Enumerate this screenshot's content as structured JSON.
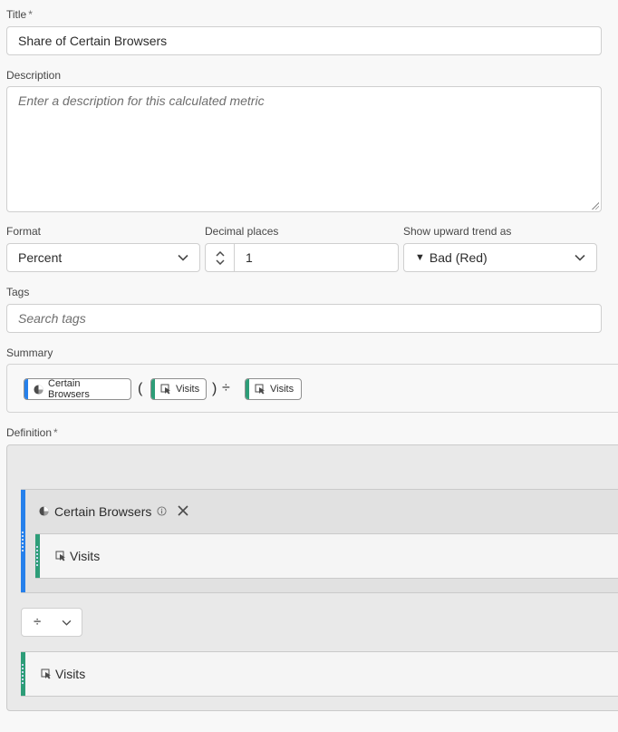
{
  "title_field": {
    "label": "Title",
    "required_mark": "*",
    "value": "Share of Certain Browsers"
  },
  "description_field": {
    "label": "Description",
    "placeholder": "Enter a description for this calculated metric"
  },
  "format_field": {
    "label": "Format",
    "value": "Percent"
  },
  "decimal_field": {
    "label": "Decimal places",
    "value": "1"
  },
  "trend_field": {
    "label": "Show upward trend as",
    "arrow": "▼",
    "value": "Bad (Red)"
  },
  "tags_field": {
    "label": "Tags",
    "placeholder": "Search tags"
  },
  "summary": {
    "label": "Summary",
    "segment_chip": "Certain Browsers",
    "open_paren": "(",
    "metric_chip_1": "Visits",
    "close_paren": ")",
    "operator": "÷",
    "metric_chip_2": "Visits"
  },
  "definition": {
    "label": "Definition",
    "required_mark": "*",
    "container_title": "Certain Browsers",
    "inner_metric": "Visits",
    "operator_symbol": "÷",
    "bottom_metric": "Visits"
  },
  "colors": {
    "segment": "#2680eb",
    "metric": "#2d9d78"
  }
}
